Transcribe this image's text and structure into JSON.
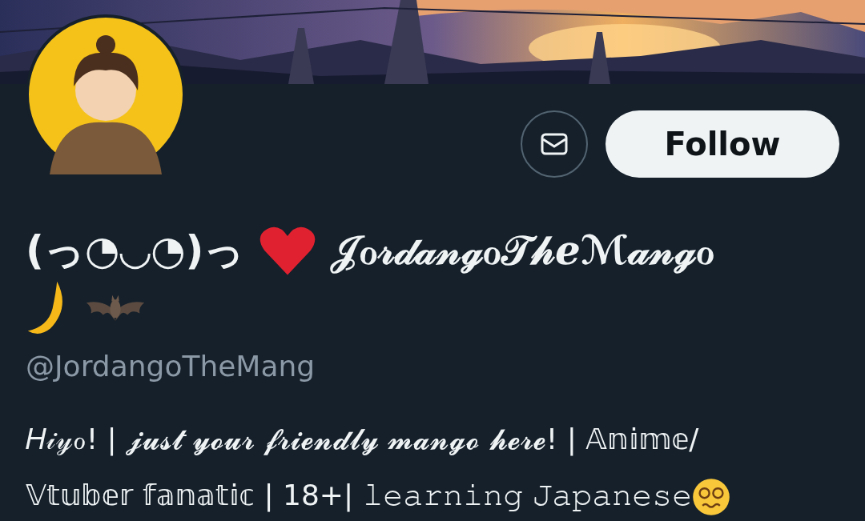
{
  "actions": [
    {
      "kind": "message"
    },
    {
      "kind": "follow",
      "label": "Follow"
    }
  ],
  "profile": {
    "name": [
      {
        "kind": "text",
        "text": "(っ◔◡◔)っ"
      },
      {
        "kind": "heart"
      },
      {
        "kind": "text",
        "text": "𝒥ℴ𝓇𝒹𝒶𝓃ℊℴ𝒯𝒽ℯℳ𝒶𝓃ℊℴ"
      },
      {
        "kind": "moon"
      },
      {
        "kind": "bat"
      }
    ],
    "handle": "@JordangoTheMang",
    "bio": [
      {
        "kind": "text",
        "text": "𝐻𝒾𝓎ℴ! | 𝓳𝓾𝓼𝓽 𝔂𝓸𝓾𝓻 𝓯𝓻𝓲𝓮𝓷𝓭𝓵𝔂 𝓶𝓪𝓷𝓰𝓸 𝓱𝓮𝓻𝓮! | 𝔸𝕟𝕚𝕞𝕖/"
      },
      {
        "kind": "text",
        "text": "𝕍𝕥𝕦𝕓𝕖𝕣 𝕗𝕒𝕟𝕒𝕥𝕚𝕔 | 18+| 𝚕𝚎𝚊𝚛𝚗𝚒𝚗𝚐 𝙹𝚊𝚙𝚊𝚗𝚎𝚜𝚎"
      },
      {
        "kind": "dizzy"
      }
    ]
  }
}
